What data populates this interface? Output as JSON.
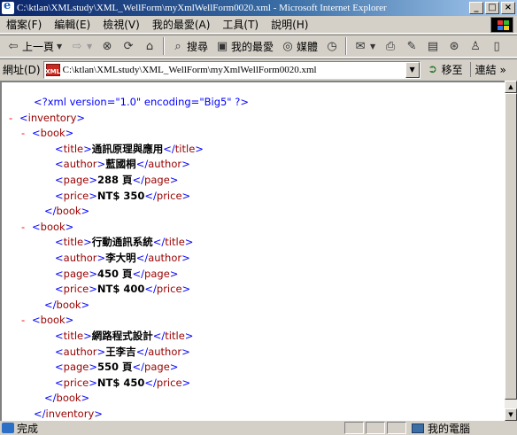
{
  "window": {
    "title": "C:\\ktlan\\XMLstudy\\XML_WellForm\\myXmlWellForm0020.xml - Microsoft Internet Explorer",
    "minimize_glyph": "_",
    "restore_glyph": "□",
    "close_glyph": "×"
  },
  "menu": [
    "檔案(F)",
    "編輯(E)",
    "檢視(V)",
    "我的最愛(A)",
    "工具(T)",
    "說明(H)"
  ],
  "toolbar": {
    "back_label": "上一頁",
    "search_label": "搜尋",
    "favorites_label": "我的最愛",
    "media_label": "媒體"
  },
  "address": {
    "label": "網址(D)",
    "value": "C:\\ktlan\\XMLstudy\\XML_WellForm\\myXmlWellForm0020.xml",
    "go_label": "移至",
    "links_label": "連結 »"
  },
  "xml": {
    "declaration": "<?xml version=\"1.0\" encoding=\"Big5\" ?>",
    "root_open": "inventory",
    "root_close": "inventory",
    "books": [
      {
        "title": "通訊原理與應用",
        "author": "藍國桐",
        "page": "288 頁",
        "price": "NT$ 350"
      },
      {
        "title": "行動通訊系統",
        "author": "李大明",
        "page": "450 頁",
        "price": "NT$ 400"
      },
      {
        "title": "網路程式設計",
        "author": "王李吉",
        "page": "550 頁",
        "price": "NT$ 450"
      }
    ]
  },
  "status": {
    "text": "完成",
    "zone": "我的電腦"
  },
  "colors": {
    "title_gradient_start": "#0a246a",
    "title_gradient_end": "#a6caf0",
    "xml_tag": "#990000",
    "xml_bracket": "#0000ff",
    "xml_toggle": "#ff0000"
  }
}
